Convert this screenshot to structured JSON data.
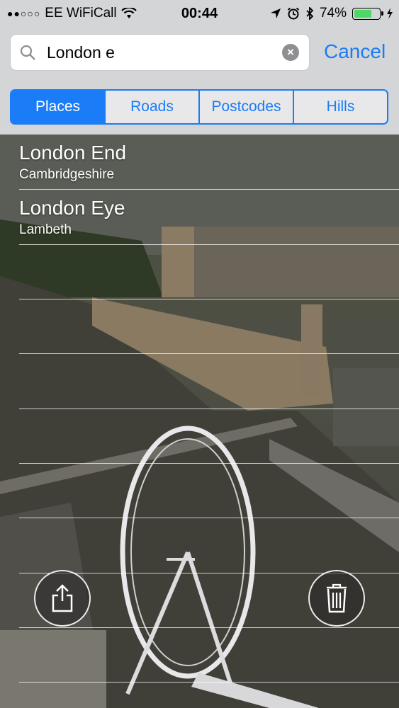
{
  "status_bar": {
    "carrier": "EE WiFiCall",
    "time": "00:44",
    "battery": "74%",
    "battery_level": 0.74,
    "signal_bars_filled": 2,
    "signal_bars_total": 5
  },
  "search": {
    "query": "London e",
    "cancel_label": "Cancel"
  },
  "segments": {
    "selected": "Places",
    "items": [
      "Places",
      "Roads",
      "Postcodes",
      "Hills"
    ]
  },
  "results": [
    {
      "title": "London End",
      "subtitle": "Cambridgeshire"
    },
    {
      "title": "London Eye",
      "subtitle": "Lambeth"
    }
  ],
  "actions": {
    "share": "share-icon",
    "delete": "trash-icon"
  },
  "colors": {
    "accent": "#1a7cf6",
    "battery": "#4cd964"
  }
}
